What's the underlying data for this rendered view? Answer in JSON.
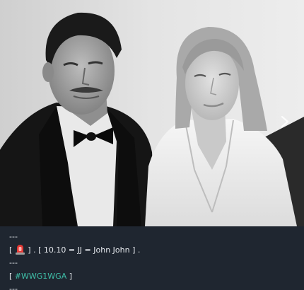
{
  "post": {
    "image": {
      "description_icon": "photo",
      "next_icon": "chevron-right-icon"
    },
    "caption": {
      "line1": "---",
      "line2_open": "[ ",
      "line2_icon": "police-siren-icon",
      "line2_rest": " ] . [ 10.10 = JJ = John John ] .",
      "line3": "---",
      "line4_open": "[ ",
      "line4_hashtag": "#WWG1WGA",
      "line4_close": " ]",
      "line5": "---"
    },
    "colors": {
      "background": "#1f2630",
      "text": "#e6e9ee",
      "hashtag": "#3fbfa8",
      "siren": "#e53935"
    }
  }
}
